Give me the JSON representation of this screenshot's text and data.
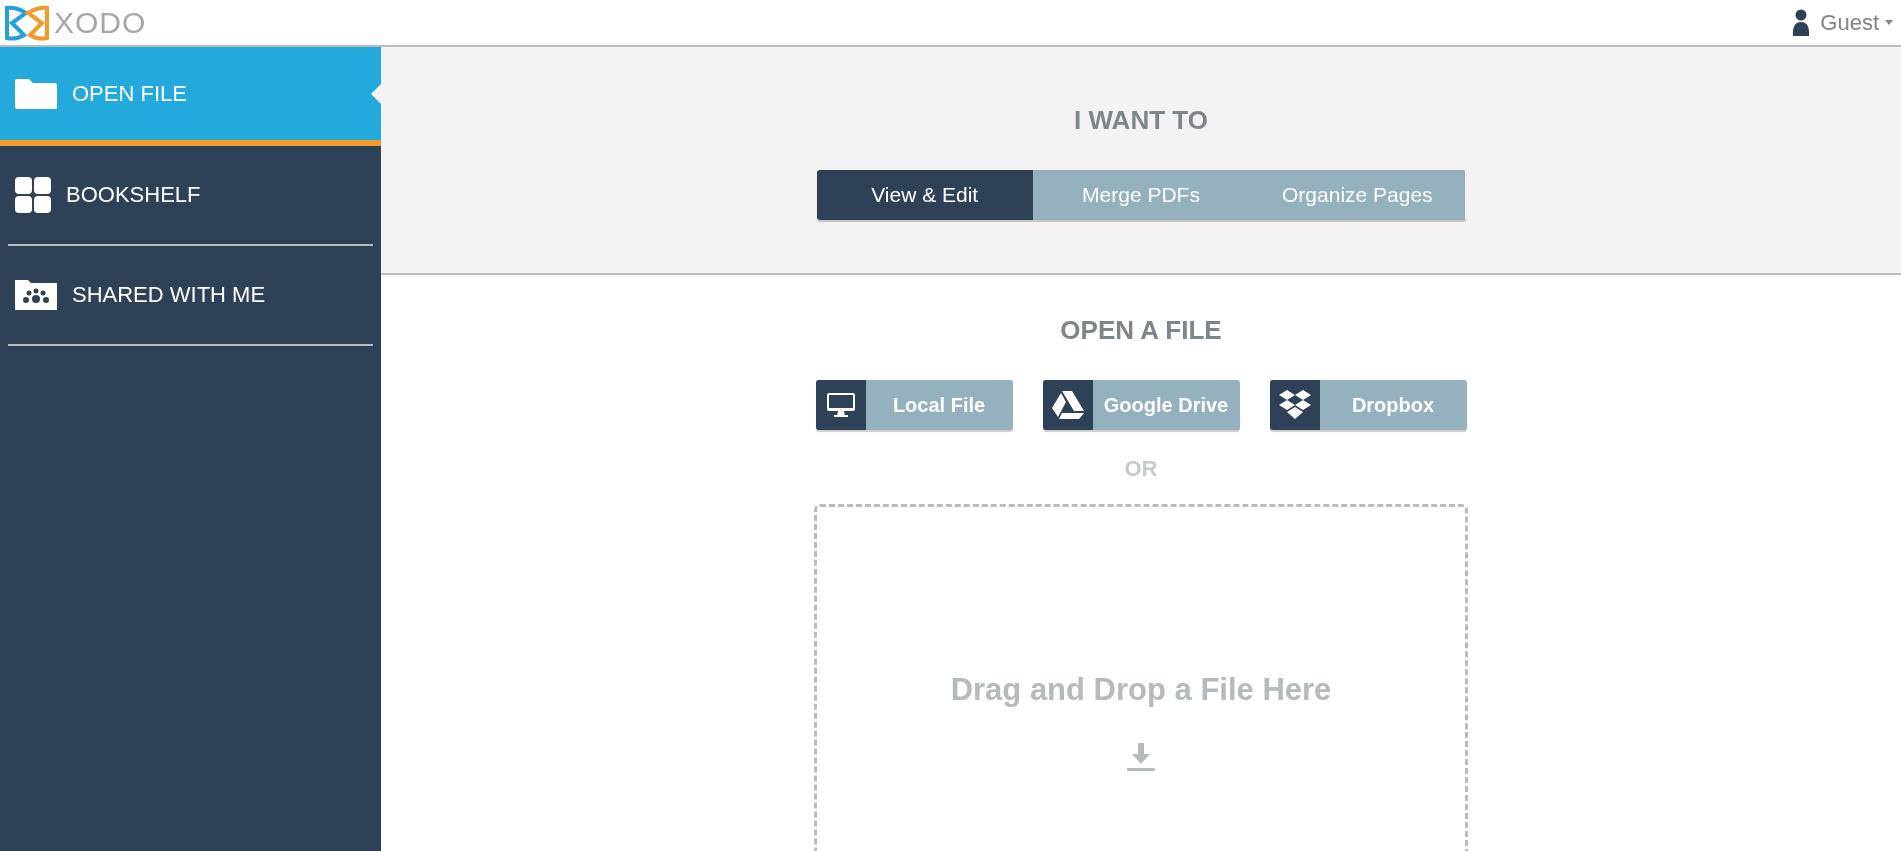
{
  "header": {
    "logo_text": "XODO",
    "user": "Guest"
  },
  "sidebar": {
    "items": [
      {
        "kind": "open",
        "label": "OPEN FILE",
        "selected": true
      },
      {
        "kind": "bookshelf",
        "label": "BOOKSHELF",
        "selected": false
      },
      {
        "kind": "shared",
        "label": "SHARED WITH ME",
        "selected": false
      }
    ]
  },
  "intent": {
    "heading": "I WANT TO",
    "tabs": [
      {
        "label": "View & Edit",
        "selected": true
      },
      {
        "label": "Merge PDFs",
        "selected": false
      },
      {
        "label": "Organize Pages",
        "selected": false
      }
    ]
  },
  "open_file": {
    "heading": "OPEN A FILE",
    "sources": [
      {
        "kind": "computer",
        "label": "Local File"
      },
      {
        "kind": "drive",
        "label": "Google Drive"
      },
      {
        "kind": "dropbox",
        "label": "Dropbox"
      }
    ],
    "separator": "OR",
    "drop_zone": {
      "text": "Drag and Drop a File Here"
    }
  }
}
